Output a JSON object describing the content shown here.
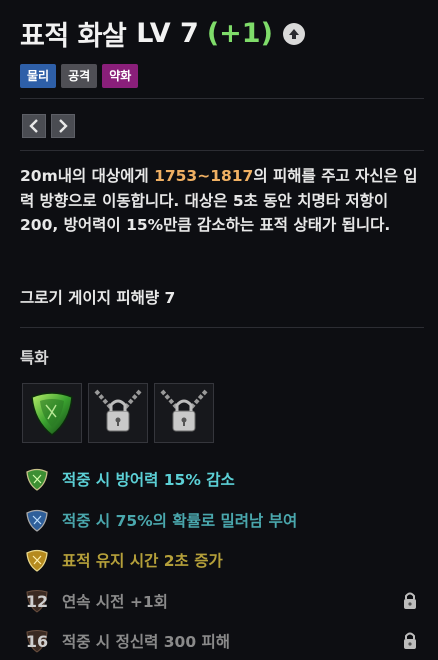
{
  "skill": {
    "name": "표적 화살",
    "level": "LV 7",
    "bonus": "(+1)"
  },
  "tags": [
    "물리",
    "공격",
    "약화"
  ],
  "description": {
    "part1": "20m내의 대상에게 ",
    "damage": "1753~1817",
    "part2": "의 피해를 주고 자신은 입력 방향으로 이동합니다. 대상은 5초 동안 치명타 저항이 200, 방어력이 15%만큼 감소하는 표적 상태가 됩니다."
  },
  "gauge": "그로기 게이지 피해량 7",
  "specialization": {
    "title": "특화"
  },
  "tripods": [
    {
      "text": "적중 시 방어력 15% 감소",
      "color": "#5cd0d6",
      "icon": "green-gem-icon"
    },
    {
      "text": "적중 시 75%의 확률로 밀려남 부여",
      "color": "#4aa7ad",
      "icon": "blue-gem-icon"
    },
    {
      "text": "표적 유지 시간 2초 증가",
      "color": "#b5a03a",
      "icon": "gold-gem-icon"
    },
    {
      "text": "연속 시전 +1회",
      "color": "#8a8a8a",
      "badge": "12",
      "icon": "lock-icon"
    },
    {
      "text": "적중 시 정신력 300 피해",
      "color": "#8a8a8a",
      "badge": "16",
      "icon": "lock-icon"
    }
  ]
}
